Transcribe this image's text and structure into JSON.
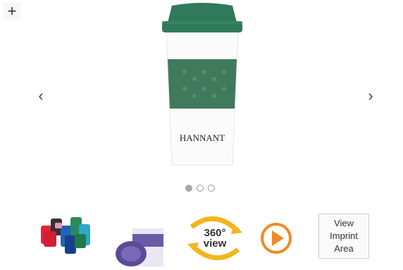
{
  "gallery": {
    "zoom_icon_glyph": "+",
    "prev_glyph": "‹",
    "next_glyph": "›",
    "brand_text": "HANNANT",
    "slides_total": 3,
    "active_slide": 1
  },
  "thumbnails": {
    "view360_top": "360°",
    "view360_bottom": "view",
    "imprint_line1": "View",
    "imprint_line2": "Imprint",
    "imprint_line3": "Area"
  },
  "colors": {
    "lid_green": "#2f7a5b",
    "sleeve_green": "#3f7a5d",
    "play_orange": "#f08a24",
    "arrow_yellow": "#f2b51c"
  }
}
